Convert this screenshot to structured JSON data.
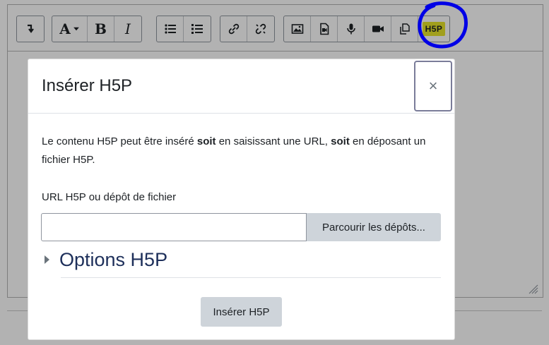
{
  "toolbar": {
    "buttons": [
      {
        "name": "collapse-toolbar",
        "icon": "arrow-down-corner-icon"
      },
      {
        "name": "font-color",
        "icon": "font-color-icon",
        "label": "A"
      },
      {
        "name": "bold",
        "icon": "bold-icon",
        "label": "B"
      },
      {
        "name": "italic",
        "icon": "italic-icon",
        "label": "I"
      },
      {
        "name": "unordered-list",
        "icon": "bullet-list-icon"
      },
      {
        "name": "ordered-list",
        "icon": "numbered-list-icon"
      },
      {
        "name": "link",
        "icon": "link-icon"
      },
      {
        "name": "unlink",
        "icon": "unlink-icon"
      },
      {
        "name": "image",
        "icon": "image-icon"
      },
      {
        "name": "media",
        "icon": "media-file-icon"
      },
      {
        "name": "record-audio",
        "icon": "microphone-icon"
      },
      {
        "name": "record-video",
        "icon": "video-camera-icon"
      },
      {
        "name": "manage-files",
        "icon": "copy-files-icon"
      },
      {
        "name": "h5p",
        "icon": "h5p-icon",
        "label": "H5P"
      }
    ],
    "h5p_badge": "H5P",
    "h5p_badge_color": "#e7e42a",
    "annotation_color": "#0000e6"
  },
  "modal": {
    "title": "Insérer H5P",
    "close_symbol": "×",
    "intro_part1": "Le contenu H5P peut être inséré ",
    "intro_bold1": "soit",
    "intro_part2": " en saisissant une URL, ",
    "intro_bold2": "soit",
    "intro_part3": " en déposant un fichier H5P.",
    "field_label": "URL H5P ou dépôt de fichier",
    "url_value": "",
    "browse_label": "Parcourir les dépôts...",
    "options_title": "Options H5P",
    "insert_label": "Insérer H5P"
  }
}
